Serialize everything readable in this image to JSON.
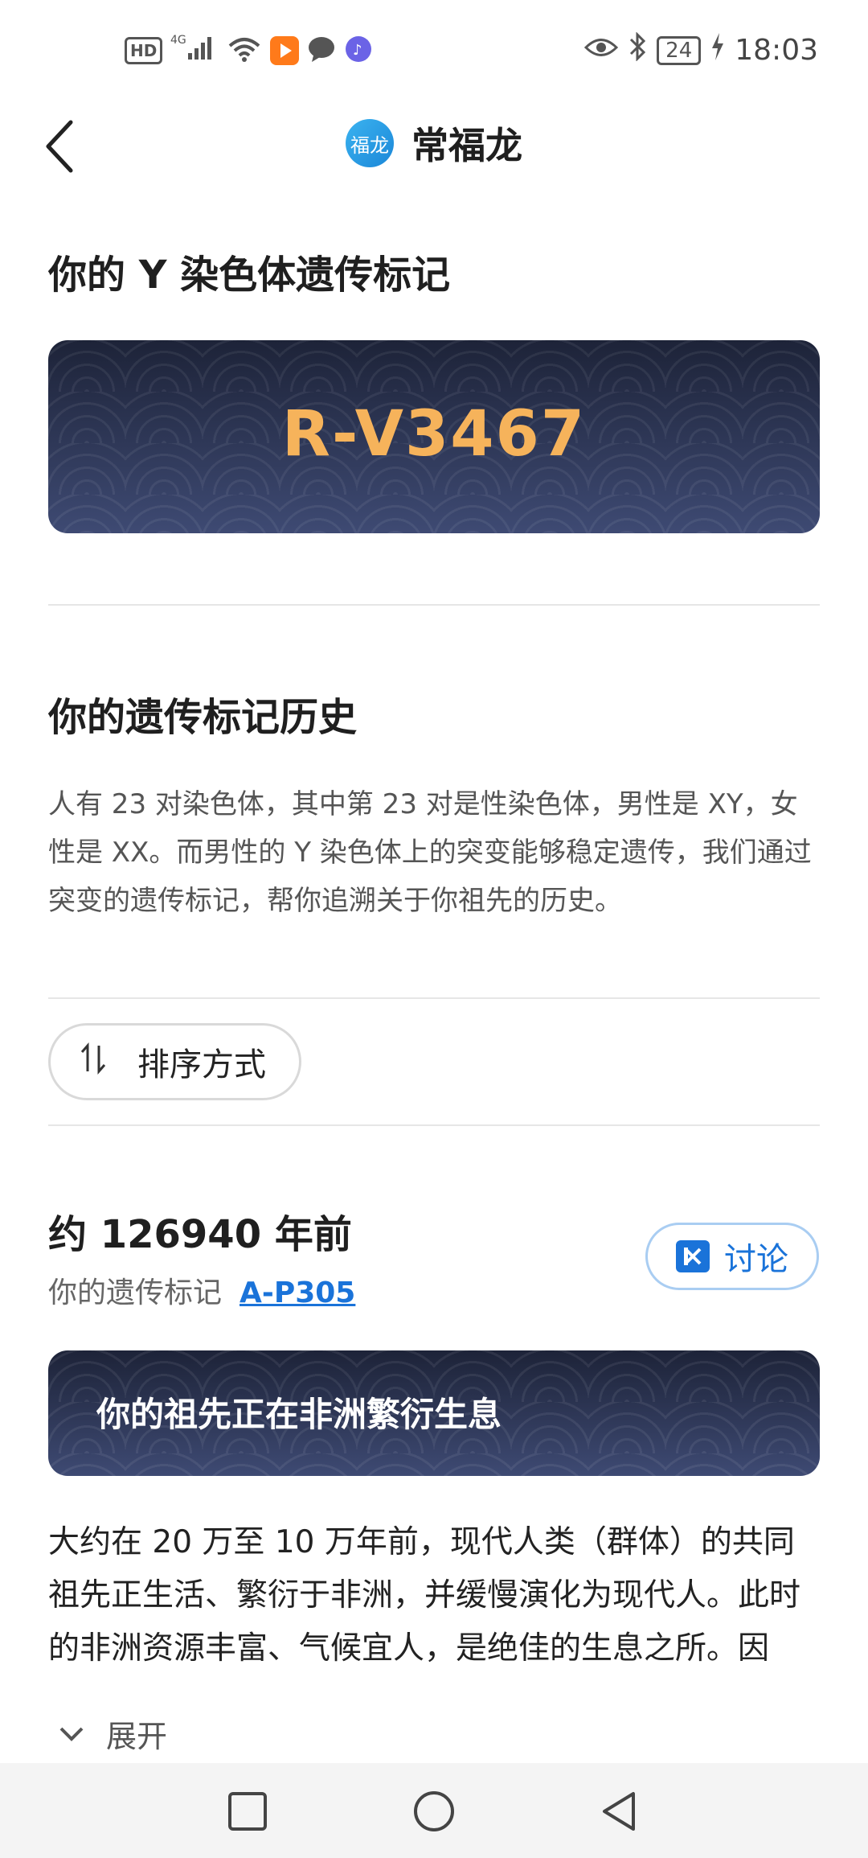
{
  "status_bar": {
    "hd": "HD",
    "network": "4G",
    "battery": "24",
    "time": "18:03"
  },
  "header": {
    "avatar_text": "福龙",
    "title": "常福龙"
  },
  "y_marker": {
    "heading": "你的 Y 染色体遗传标记",
    "code": "R-V3467"
  },
  "history": {
    "heading": "你的遗传标记历史",
    "description": "人有 23 对染色体，其中第 23 对是性染色体，男性是 XY，女性是 XX。而男性的 Y 染色体上的突变能够稳定遗传，我们通过突变的遗传标记，帮你追溯关于你祖先的历史。"
  },
  "sort": {
    "icon": "⇅",
    "label": "排序方式"
  },
  "entry": {
    "age": "约 126940 年前",
    "marker_prefix": "你的遗传标记",
    "marker_link": "A-P305",
    "discuss_label": "讨论",
    "banner": "你的祖先正在非洲繁衍生息",
    "story": "大约在 20 万至 10 万年前，现代人类（群体）的共同祖先正生活、繁衍于非洲，并缓慢演化为现代人。此时的非洲资源丰富、气候宜人，是绝佳的生息之所。因此，",
    "expand_label": "展开"
  },
  "colors": {
    "accent": "#1a73d9",
    "marker_code": "#f6b35b",
    "card_bg": "#2a3350"
  }
}
